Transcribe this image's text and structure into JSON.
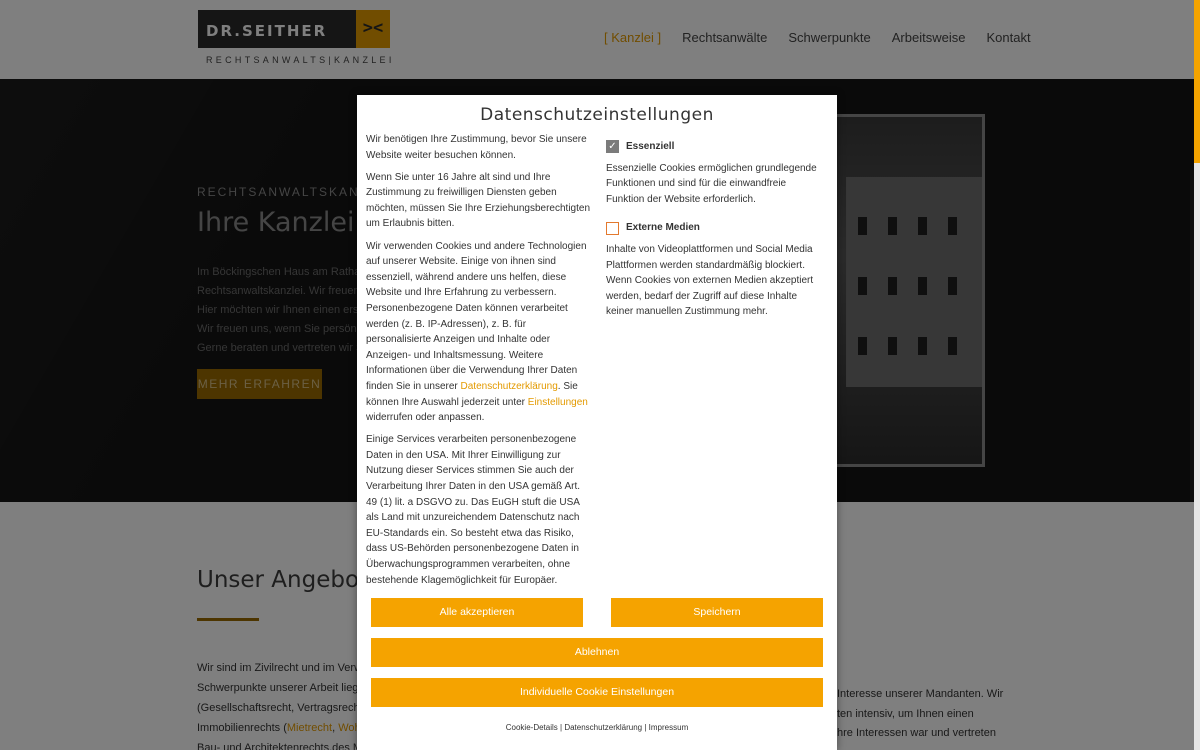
{
  "header": {
    "logo_name": "DR.SEITHER",
    "logo_mark": "><",
    "logo_sub": "RECHTSANWALTS|KANZLEI",
    "nav": [
      {
        "label": "[ Kanzlei ]",
        "active": true
      },
      {
        "label": "Rechtsanwälte",
        "active": false
      },
      {
        "label": "Schwerpunkte",
        "active": false
      },
      {
        "label": "Arbeitsweise",
        "active": false
      },
      {
        "label": "Kontakt",
        "active": false
      }
    ]
  },
  "hero": {
    "kicker": "RECHTSANWALTSKANZLEI I",
    "title": "Ihre Kanzlei im",
    "lines": [
      "Im Böckingschen Haus am Rathauspla",
      "Rechtsanwaltskanzlei. Wir freuen uns",
      "Hier möchten wir Ihnen einen ersten E",
      "Wir freuen uns, wenn Sie persönlich m",
      "Gerne beraten und vertreten wir Sie in"
    ],
    "button": "MEHR ERFAHREN"
  },
  "section": {
    "title": "Unser Angebot f",
    "lines": [
      "Wir sind im Zivilrecht und im Verwaltu",
      "Schwerpunkte unserer Arbeit liegen in",
      "(Gesellschaftsrecht, Vertragsrecht, Ar",
      "Immobilienrechts (",
      "Bau- und Architektenrechts,des Medi"
    ],
    "link1": "Mietrecht",
    "sep": ", ",
    "link2": "Wohnu",
    "right_lines": [
      "Interesse unserer Mandanten. Wir",
      "ten intensiv, um Ihnen einen",
      "hre Interessen war und vertreten"
    ]
  },
  "modal": {
    "title": "Datenschutzeinstellungen",
    "p1": "Wir benötigen Ihre Zustimmung, bevor Sie unsere Website weiter besuchen können.",
    "p2": "Wenn Sie unter 16 Jahre alt sind und Ihre Zustimmung zu freiwilligen Diensten geben möchten, müssen Sie Ihre Erziehungsberechtigten um Erlaubnis bitten.",
    "p3a": "Wir verwenden Cookies und andere Technologien auf unserer Website. Einige von ihnen sind essenziell, während andere uns helfen, diese Website und Ihre Erfahrung zu verbessern. Personenbezogene Daten können verarbeitet werden (z. B. IP-Adressen), z. B. für personalisierte Anzeigen und Inhalte oder Anzeigen- und Inhaltsmessung. Weitere Informationen über die Verwendung Ihrer Daten finden Sie in unserer ",
    "p3_link1": "Datenschutzerklärung",
    "p3b": ". Sie können Ihre Auswahl jederzeit unter ",
    "p3_link2": "Einstellungen",
    "p3c": " widerrufen oder anpassen.",
    "p4": "Einige Services verarbeiten personenbezogene Daten in den USA. Mit Ihrer Einwilligung zur Nutzung dieser Services stimmen Sie auch der Verarbeitung Ihrer Daten in den USA gemäß Art. 49 (1) lit. a DSGVO zu. Das EuGH stuft die USA als Land mit unzureichendem Datenschutz nach EU-Standards ein. So besteht etwa das Risiko, dass US-Behörden personenbezogene Daten in Überwachungsprogrammen verarbeiten, ohne bestehende Klagemöglichkeit für Europäer.",
    "categories": [
      {
        "label": "Essenziell",
        "checked": true,
        "check_glyph": "✓",
        "desc": "Essenzielle Cookies ermöglichen grundlegende Funktionen und sind für die einwandfreie Funktion der Website erforderlich."
      },
      {
        "label": "Externe Medien",
        "checked": false,
        "check_glyph": "",
        "desc": "Inhalte von Videoplattformen und Social Media Plattformen werden standardmäßig blockiert. Wenn Cookies von externen Medien akzeptiert werden, bedarf der Zugriff auf diese Inhalte keiner manuellen Zustimmung mehr."
      }
    ],
    "buttons": {
      "accept_all": "Alle akzeptieren",
      "save": "Speichern",
      "reject": "Ablehnen",
      "individual": "Individuelle Cookie Einstellungen"
    },
    "footer": {
      "cookie_details": "Cookie-Details",
      "privacy": "Datenschutzerklärung",
      "imprint": "Impressum",
      "sep": " | "
    }
  }
}
